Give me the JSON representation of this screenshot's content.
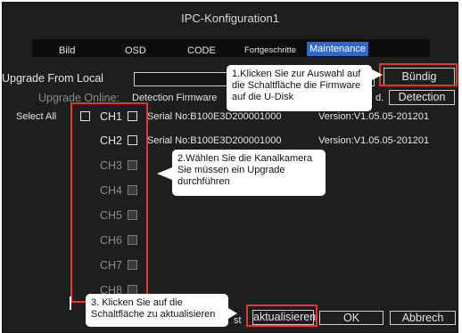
{
  "window": {
    "title": "IPC-Konfiguration1"
  },
  "tabs": [
    {
      "label": "Bild"
    },
    {
      "label": "OSD"
    },
    {
      "label": "CODE"
    },
    {
      "label": "Fortgeschritte"
    },
    {
      "label": "Maintenance",
      "active": true
    }
  ],
  "upgrade_local": {
    "label": "Upgrade From Local",
    "button": "Bündig"
  },
  "upgrade_online": {
    "label": "Upgrade Online:",
    "detection_text": "Detection Firmware",
    "suffix": "d.",
    "button": "Detection"
  },
  "select_all": {
    "label": "Select All"
  },
  "channels": [
    {
      "name": "CH1",
      "serial": "Serial No:B100E3D200001000",
      "version": "Version:V1.05.05-201201",
      "enabled": true
    },
    {
      "name": "CH2",
      "serial": "Serial No:B100E3D200001000",
      "version": "Version:V1.05.05-201201",
      "enabled": true
    },
    {
      "name": "CH3",
      "enabled": false
    },
    {
      "name": "CH4",
      "enabled": false
    },
    {
      "name": "CH5",
      "enabled": false
    },
    {
      "name": "CH6",
      "enabled": false
    },
    {
      "name": "CH7",
      "enabled": false
    },
    {
      "name": "CH8",
      "enabled": false
    }
  ],
  "buttons": {
    "update": "aktualisieren",
    "ok": "OK",
    "cancel": "Abbrech",
    "partial": "st"
  },
  "callouts": {
    "c1": "1.Klicken Sie zur Auswahl auf die Schaltfläche die Firmware auf die U-Disk",
    "c2": "2.Wählen Sie die Kanalkamera Sie müssen ein Upgrade durchführen",
    "c3": "3. Klicken Sie auf die Schaltfläche zu aktualisieren"
  },
  "colors": {
    "accent": "#2e68c8",
    "highlight": "#e8352a",
    "background": "#1e1e1e"
  }
}
